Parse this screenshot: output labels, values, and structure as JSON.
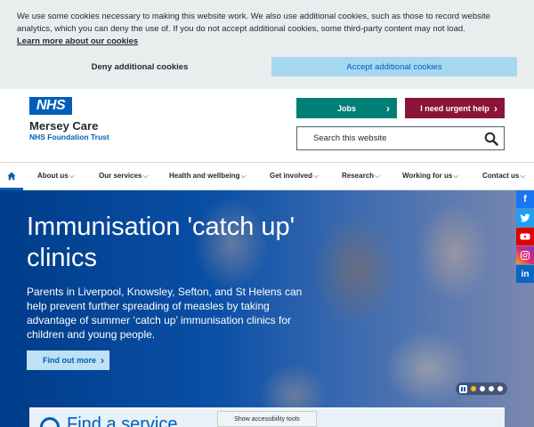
{
  "cookie_banner": {
    "text": "We use some cookies necessary to making this website work. We also use additional cookies, such as those to record website analytics, which you can deny the use of. If you do not accept additional cookies, some third-party content may not load.",
    "learn_more": "Learn more about our cookies",
    "deny_label": "Deny additional cookies",
    "accept_label": "Accept additional cookies"
  },
  "header": {
    "logo_text": "NHS",
    "org_name": "Mersey Care",
    "org_sub": "NHS Foundation Trust",
    "jobs_label": "Jobs",
    "urgent_label": "I need urgent help",
    "search_placeholder": "Search this website"
  },
  "nav": {
    "items": [
      {
        "label": "About us"
      },
      {
        "label": "Our services"
      },
      {
        "label": "Health and wellbeing"
      },
      {
        "label": "Get involved"
      },
      {
        "label": "Research"
      },
      {
        "label": "Working for us"
      },
      {
        "label": "Contact us"
      }
    ]
  },
  "hero": {
    "title": "Immunisation 'catch up' clinics",
    "description": "Parents in Liverpool, Knowsley, Sefton, and St Helens can help prevent further spreading of measles by taking advantage of summer ‘catch up’ immunisation clinics for children and young people.",
    "cta_label": "Find out more",
    "slides_total": 4,
    "slide_active": 1
  },
  "find_panel": {
    "text": "Find a service"
  },
  "accessibility": {
    "label": "Show accessibility tools"
  },
  "social": [
    "facebook-icon",
    "twitter-icon",
    "youtube-icon",
    "instagram-icon",
    "linkedin-icon"
  ],
  "colors": {
    "nhs_blue": "#005eb8",
    "jobs_green": "#007f77",
    "urgent_maroon": "#8a1538",
    "accept_blue": "#a6d8f0"
  }
}
